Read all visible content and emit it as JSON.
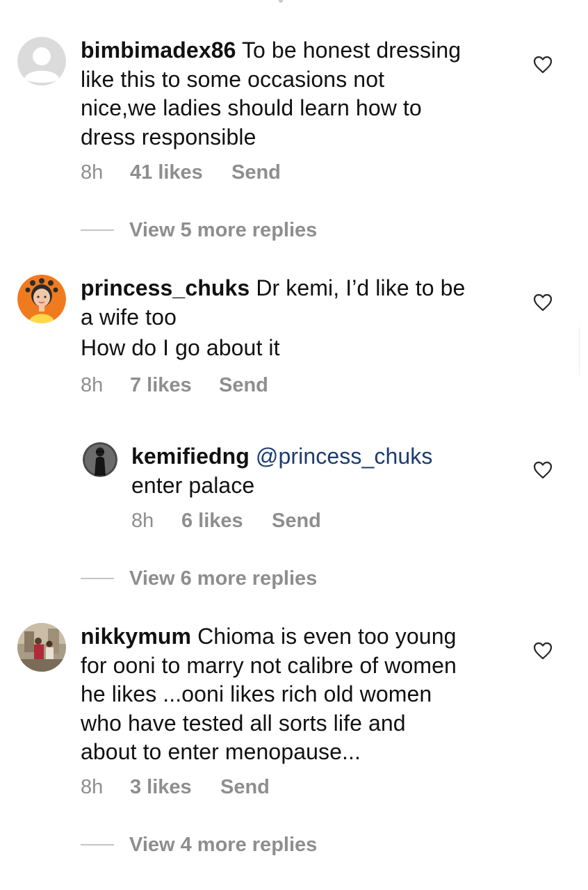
{
  "comments": [
    {
      "username": "bimbimadex86",
      "text": "To be honest dressing like this to some occasions  not nice,we ladies should learn how to dress responsible",
      "lines": [
        "To be honest dressing",
        "like this to some occasions  not",
        "nice,we ladies should learn how to",
        "dress responsible"
      ],
      "time": "8h",
      "likes": "41 likes",
      "send": "Send",
      "view_replies": "View 5 more replies",
      "avatar": "default-avatar-icon"
    },
    {
      "username": "princess_chuks",
      "text": "Dr kemi, I’d like to be a wife too How do I go about it",
      "lines": [
        "Dr kemi, I’d like to be",
        "a wife too",
        "How do I go about it"
      ],
      "time": "8h",
      "likes": "7 likes",
      "send": "Send",
      "avatar": "cartoon-girl-avatar",
      "reply": {
        "username": "kemifiedng",
        "mention": "@princess_chuks",
        "text": "enter palace",
        "time": "8h",
        "likes": "6 likes",
        "send": "Send",
        "avatar": "person-silhouette-avatar"
      },
      "view_replies": "View 6 more replies"
    },
    {
      "username": "nikkymum",
      "text": "Chioma is even too young for ooni to marry  not calibre of women he likes ...ooni likes rich old women who have tested all sorts life and about to enter menopause...",
      "lines": [
        "Chioma is even too young",
        "for ooni to marry  not calibre of women",
        "he likes ...ooni likes rich old women",
        "who have tested all sorts life and",
        "about to enter menopause..."
      ],
      "time": "8h",
      "likes": "3 likes",
      "send": "Send",
      "view_replies": "View 4 more replies",
      "avatar": "photo-avatar"
    }
  ],
  "colors": {
    "text": "#111111",
    "meta": "#8e8e8e",
    "mention": "#1d3b6f",
    "divider": "#c4c4c4"
  },
  "icons": {
    "like": "heart-outline-icon"
  }
}
